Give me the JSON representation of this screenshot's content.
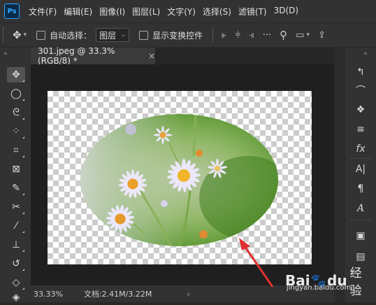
{
  "app": {
    "logo": "Ps"
  },
  "menu": [
    "文件(F)",
    "编辑(E)",
    "图像(I)",
    "图层(L)",
    "文字(Y)",
    "选择(S)",
    "滤镜(T)",
    "3D(D)"
  ],
  "options_bar": {
    "auto_select_label": "自动选择：",
    "auto_select_value": "图层",
    "show_transform_label": "显示变换控件"
  },
  "document_tab": {
    "title": "301.jpeg @ 33.3%(RGB/8) *",
    "close": "×"
  },
  "toolbar_header": {
    "collapse": "»",
    "close": "×"
  },
  "status": {
    "zoom": "33.33%",
    "doc_size": "文档:2.41M/3.22M",
    "arrow": "›"
  },
  "watermark": {
    "brand": "Bai",
    "paw": "🐾",
    "brand2": "du",
    "sub": "经验",
    "url": "jingyan.baidu.com"
  },
  "colors": {
    "accent": "#31a8ff",
    "arrow": "#e03030",
    "background": "#282828",
    "panel": "#323232"
  },
  "tools_icons": [
    "move-icon",
    "elliptical-marquee-icon",
    "lasso-icon",
    "quick-select-icon",
    "crop-icon",
    "frame-icon",
    "eyedropper-icon",
    "healing-brush-icon",
    "brush-icon",
    "stamp-icon",
    "history-brush-icon",
    "eraser-icon",
    "paint-bucket-icon"
  ],
  "right_panel_icons": [
    "history-icon",
    "paths-icon",
    "channels-icon",
    "adjustments-icon",
    "fx-icon",
    "character-icon",
    "paragraph-icon",
    "glyphs-icon",
    "gradient-icon",
    "properties-icon"
  ]
}
